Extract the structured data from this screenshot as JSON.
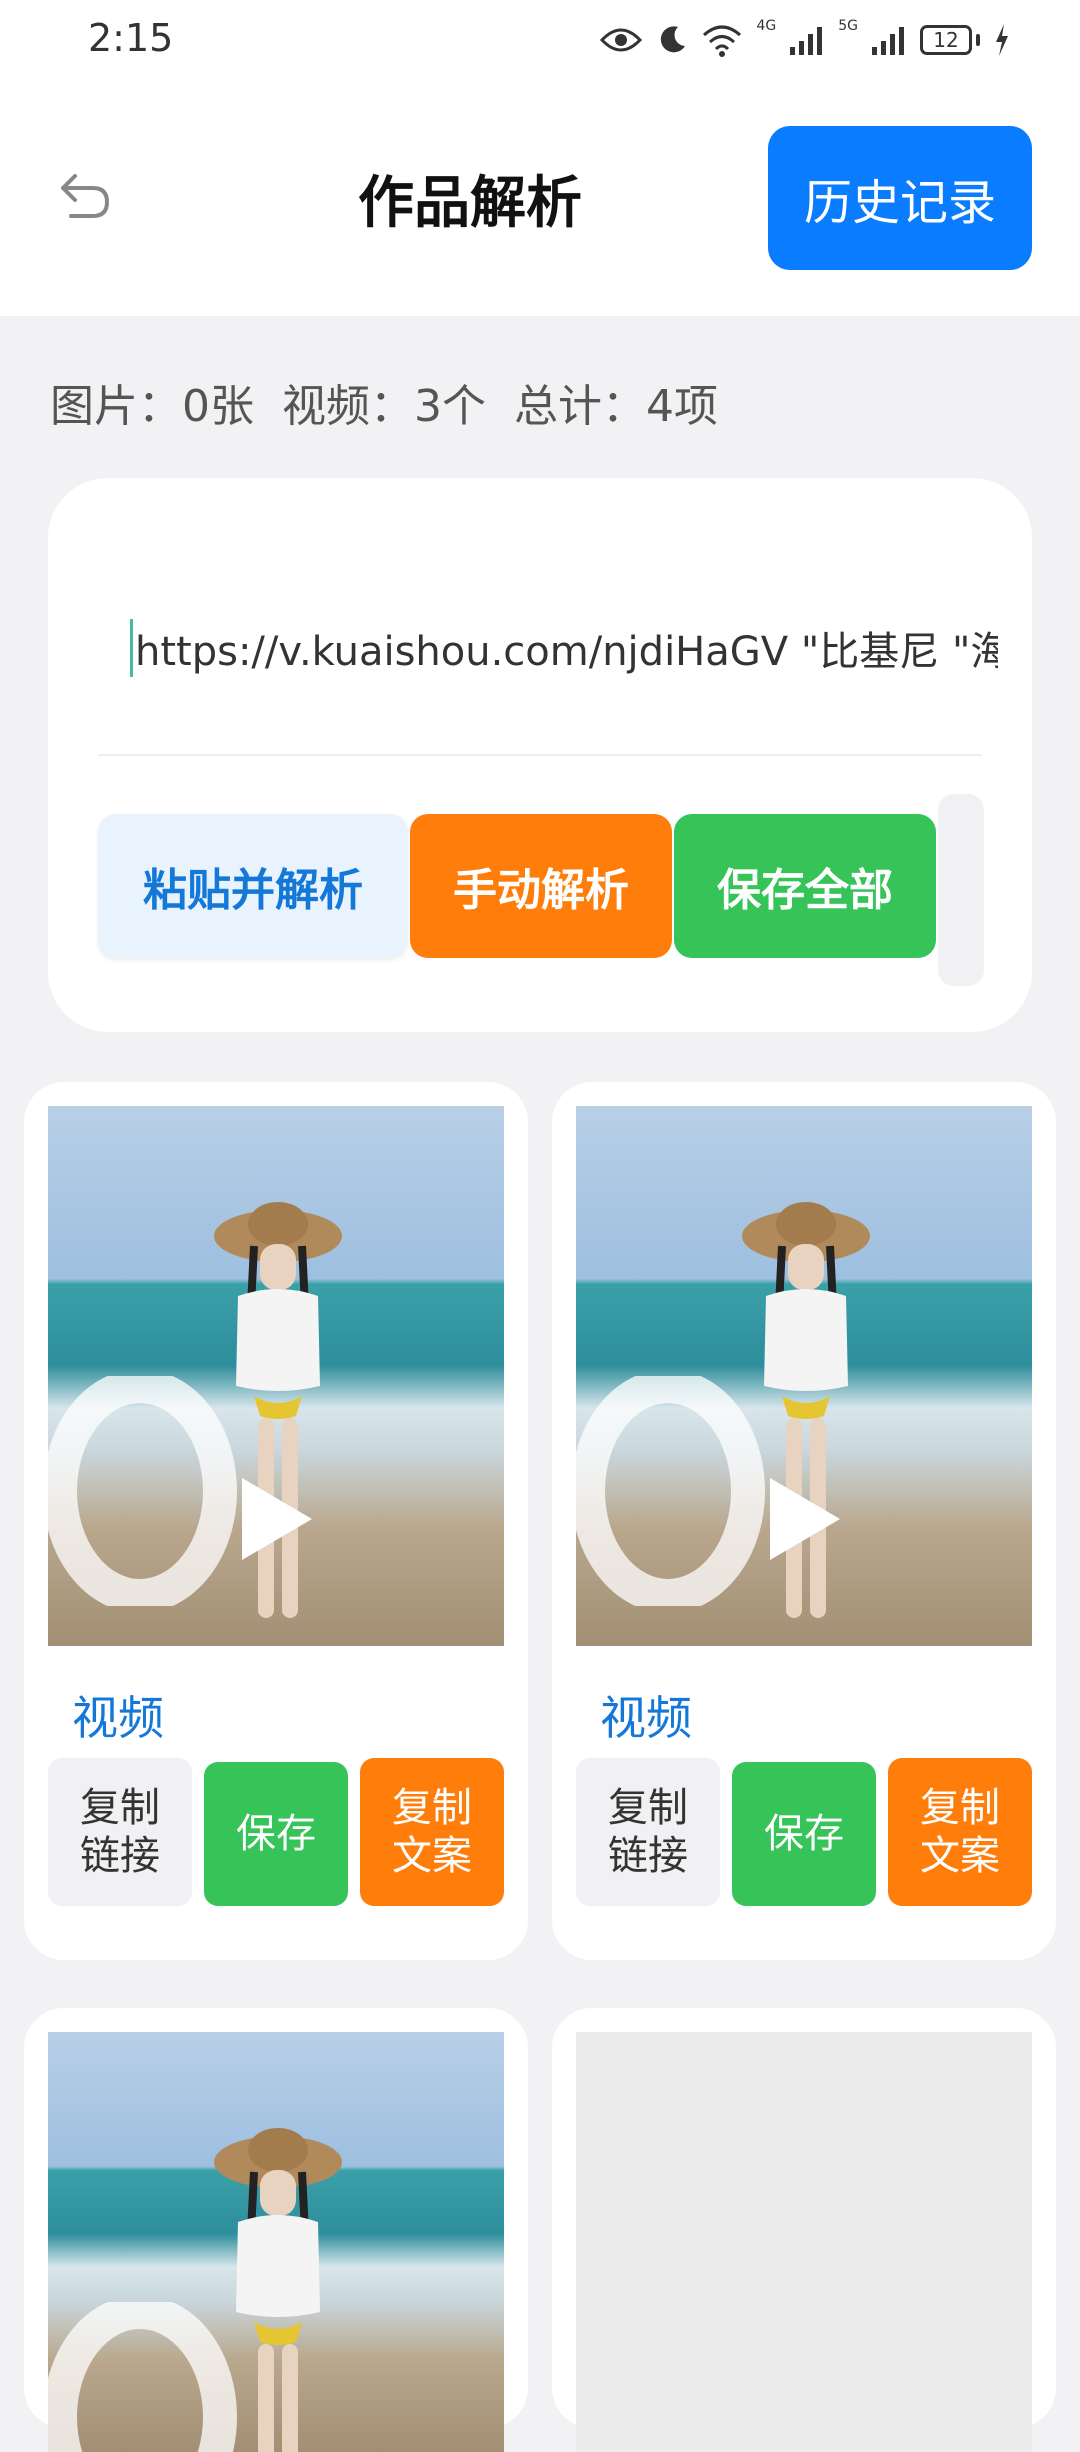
{
  "status_bar": {
    "time": "2:15",
    "battery": "12",
    "net1": "4G",
    "net2": "5G"
  },
  "header": {
    "title": "作品解析",
    "history_label": "历史记录"
  },
  "summary": {
    "images": "图片：0张",
    "videos": "视频：3个",
    "total": "总计：4项"
  },
  "input": {
    "value": "https://v.kuaishou.com/njdiHaGV \"比基尼 \"海"
  },
  "actions": {
    "paste_parse": "粘贴并解析",
    "manual_parse": "手动解析",
    "save_all": "保存全部"
  },
  "cards": [
    {
      "type": "视频",
      "copy_link": "复制\n链接",
      "save": "保存",
      "copy_text": "复制\n文案"
    },
    {
      "type": "视频",
      "copy_link": "复制\n链接",
      "save": "保存",
      "copy_text": "复制\n文案"
    }
  ],
  "colors": {
    "accent_blue": "#0a7cff",
    "orange": "#ff7d0a",
    "green": "#36c458"
  }
}
